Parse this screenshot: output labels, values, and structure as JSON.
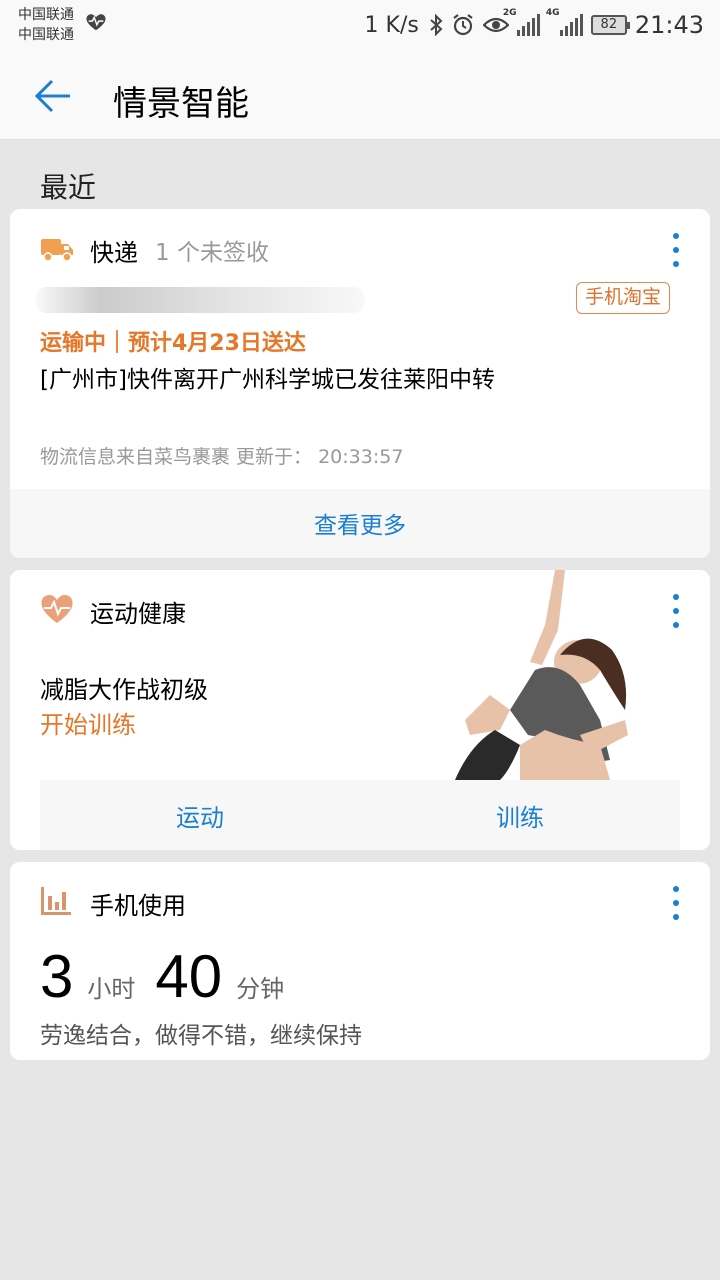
{
  "status_bar": {
    "carrier_1": "中国联通",
    "carrier_2": "中国联通",
    "speed": "1 K/s",
    "network_1": "2G",
    "network_2": "4G",
    "battery": "82",
    "time": "21:43"
  },
  "app_bar": {
    "title": "情景智能"
  },
  "section_label": "最近",
  "express_card": {
    "title": "快递",
    "subtitle": "1 个未签收",
    "source_tag": "手机淘宝",
    "status": "运输中｜预计4月23日送达",
    "info": "[广州市]快件离开广州科学城已发往莱阳中转",
    "source": "物流信息来自菜鸟裹裹  更新于：  20:33:57",
    "view_more": "查看更多"
  },
  "health_card": {
    "title": "运动健康",
    "plan_name": "减脂大作战初级",
    "start_label": "开始训练",
    "tabs": [
      "运动",
      "训练"
    ]
  },
  "usage_card": {
    "title": "手机使用",
    "hours": "3",
    "hours_unit": "小时",
    "minutes": "40",
    "minutes_unit": "分钟",
    "note": "劳逸结合，做得不错，继续保持"
  },
  "colors": {
    "accent_blue": "#1a7fd4",
    "accent_orange": "#e67728"
  }
}
